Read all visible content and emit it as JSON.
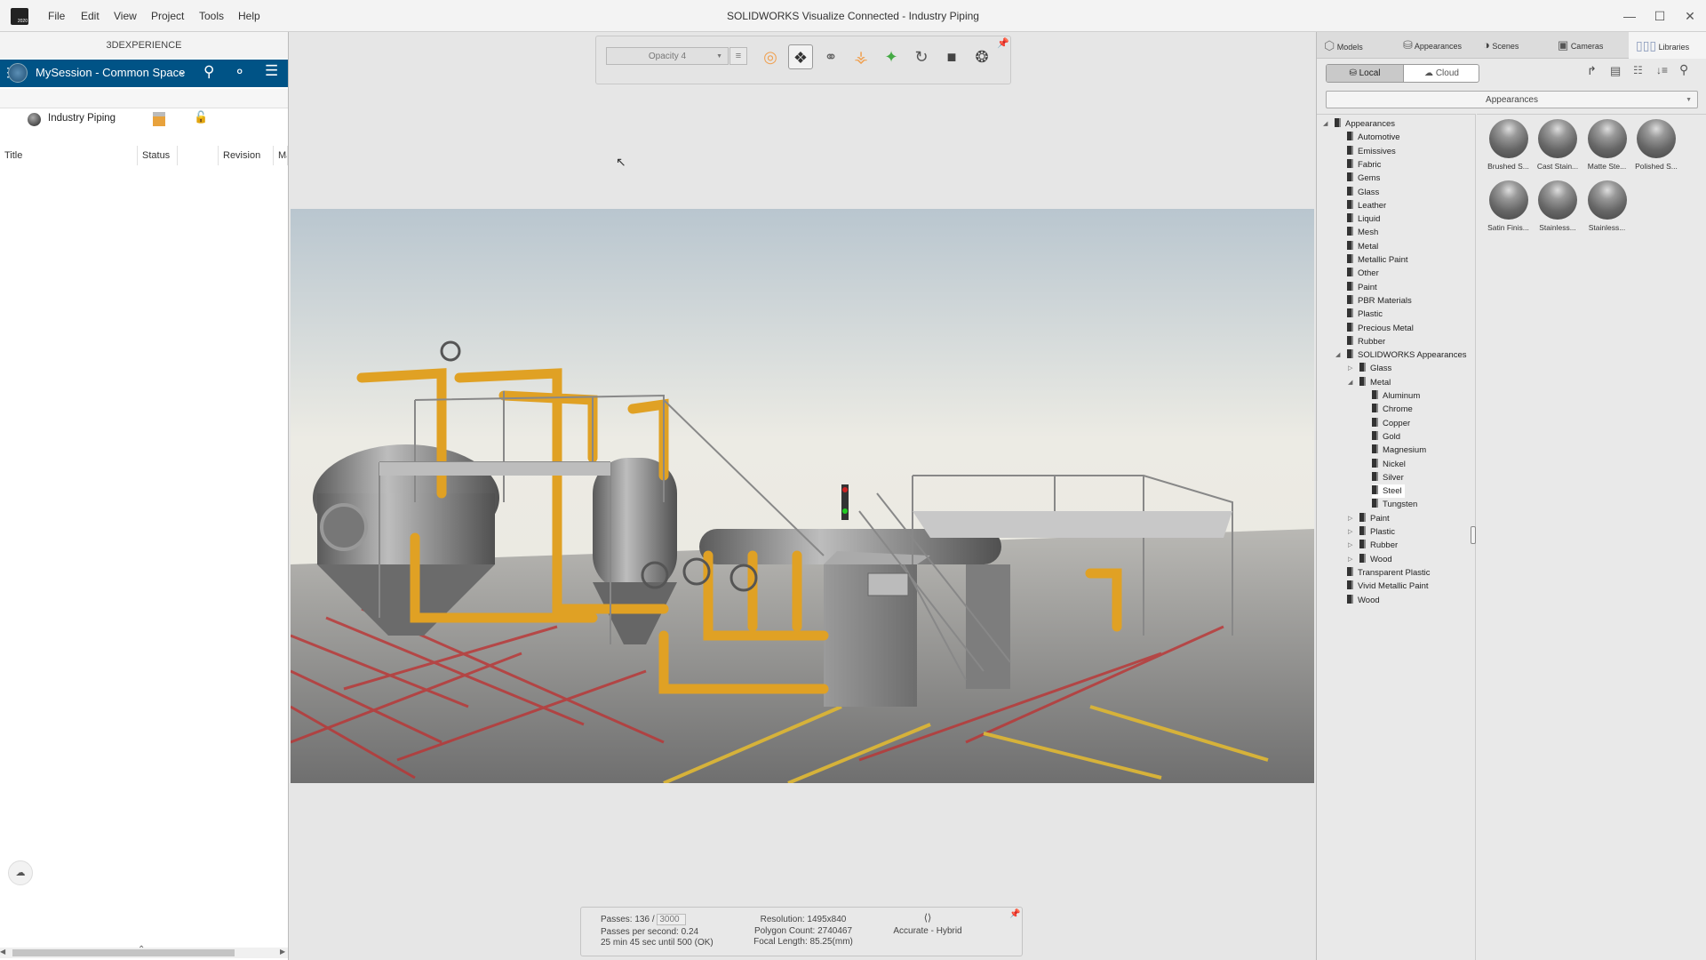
{
  "window": {
    "title": "SOLIDWORKS Visualize Connected - Industry Piping",
    "logo_text": "2020"
  },
  "menu": [
    "File",
    "Edit",
    "View",
    "Project",
    "Tools",
    "Help"
  ],
  "left_panel": {
    "header": "3DEXPERIENCE",
    "session": "MySession - Common Space",
    "columns": [
      "Title",
      "Status",
      "Revision",
      "Ma"
    ],
    "rows": [
      {
        "title": "Industry Piping"
      }
    ],
    "accent": "#005386"
  },
  "toolbar": {
    "opacity": "Opacity 4"
  },
  "status": {
    "passes_label": "Passes: 136 /",
    "passes_max": "3000",
    "pps": "Passes per second: 0.24",
    "eta": "25 min 45 sec until 500 (OK)",
    "resolution": "Resolution: 1495x840",
    "polygons": "Polygon Count: 2740467",
    "focal": "Focal Length: 85.25(mm)",
    "mode": "Accurate - Hybrid"
  },
  "right_panel": {
    "tabs": [
      "Models",
      "Appearances",
      "Scenes",
      "Cameras",
      "Libraries"
    ],
    "active_tab": "Libraries",
    "source": [
      "Local",
      "Cloud"
    ],
    "dropdown": "Appearances",
    "tree": [
      {
        "label": "Appearances",
        "level": 0,
        "expanded": true
      },
      {
        "label": "Automotive",
        "level": 1
      },
      {
        "label": "Emissives",
        "level": 1
      },
      {
        "label": "Fabric",
        "level": 1
      },
      {
        "label": "Gems",
        "level": 1
      },
      {
        "label": "Glass",
        "level": 1
      },
      {
        "label": "Leather",
        "level": 1
      },
      {
        "label": "Liquid",
        "level": 1
      },
      {
        "label": "Mesh",
        "level": 1
      },
      {
        "label": "Metal",
        "level": 1
      },
      {
        "label": "Metallic Paint",
        "level": 1
      },
      {
        "label": "Other",
        "level": 1
      },
      {
        "label": "Paint",
        "level": 1
      },
      {
        "label": "PBR Materials",
        "level": 1
      },
      {
        "label": "Plastic",
        "level": 1
      },
      {
        "label": "Precious Metal",
        "level": 1
      },
      {
        "label": "Rubber",
        "level": 1
      },
      {
        "label": "SOLIDWORKS Appearances",
        "level": 1,
        "expanded": true
      },
      {
        "label": "Glass",
        "level": 2,
        "collapsed": true
      },
      {
        "label": "Metal",
        "level": 2,
        "expanded": true
      },
      {
        "label": "Aluminum",
        "level": 3
      },
      {
        "label": "Chrome",
        "level": 3
      },
      {
        "label": "Copper",
        "level": 3
      },
      {
        "label": "Gold",
        "level": 3
      },
      {
        "label": "Magnesium",
        "level": 3
      },
      {
        "label": "Nickel",
        "level": 3
      },
      {
        "label": "Silver",
        "level": 3
      },
      {
        "label": "Steel",
        "level": 3,
        "selected": true
      },
      {
        "label": "Tungsten",
        "level": 3
      },
      {
        "label": "Paint",
        "level": 2,
        "collapsed": true
      },
      {
        "label": "Plastic",
        "level": 2,
        "collapsed": true
      },
      {
        "label": "Rubber",
        "level": 2,
        "collapsed": true
      },
      {
        "label": "Wood",
        "level": 2,
        "collapsed": true
      },
      {
        "label": "Transparent Plastic",
        "level": 1
      },
      {
        "label": "Vivid Metallic Paint",
        "level": 1
      },
      {
        "label": "Wood",
        "level": 1
      }
    ],
    "thumbnails": [
      "Brushed S...",
      "Cast Stain...",
      "Matte Ste...",
      "Polished S...",
      "Satin Finis...",
      "Stainless...",
      "Stainless..."
    ]
  }
}
